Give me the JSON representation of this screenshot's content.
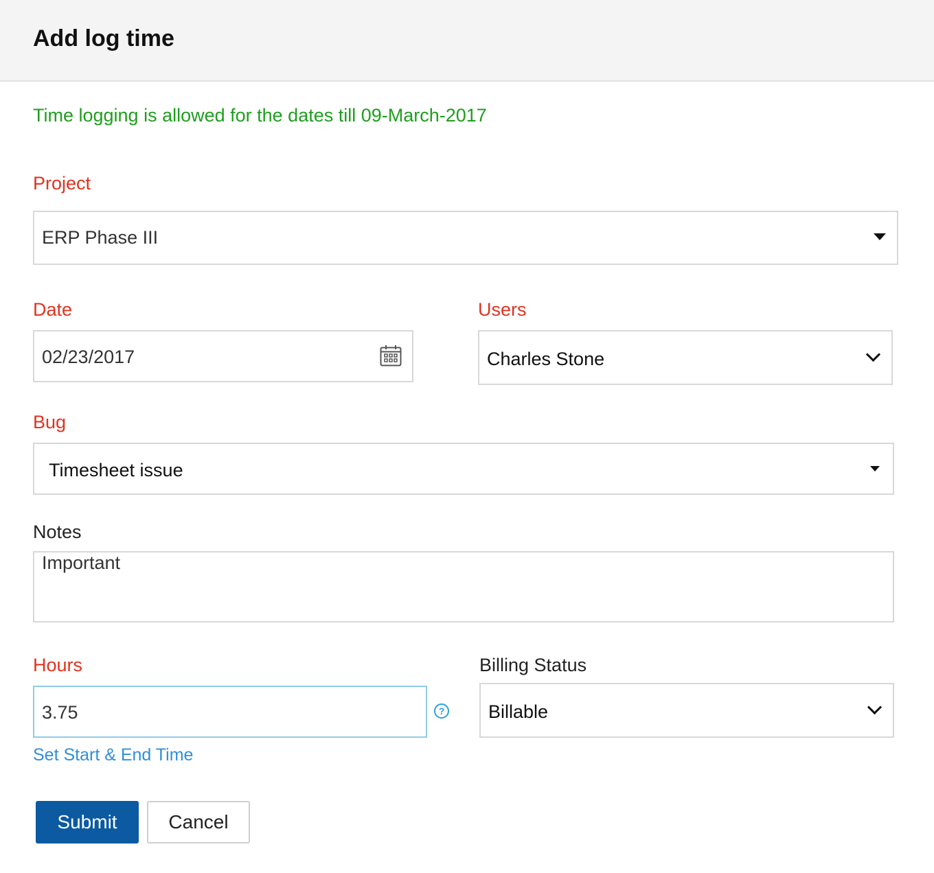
{
  "dialog": {
    "title": "Add log time"
  },
  "info_message": "Time logging is allowed for the dates till 09-March-2017",
  "project": {
    "label": "Project",
    "value": "ERP Phase III"
  },
  "date": {
    "label": "Date",
    "value": "02/23/2017"
  },
  "users": {
    "label": "Users",
    "value": "Charles Stone"
  },
  "bug": {
    "label": "Bug",
    "value": "Timesheet issue"
  },
  "notes": {
    "label": "Notes",
    "value": "Important"
  },
  "hours": {
    "label": "Hours",
    "value": "3.75",
    "help_symbol": "?"
  },
  "billing": {
    "label": "Billing Status",
    "value": "Billable"
  },
  "set_time_link": "Set Start & End Time",
  "buttons": {
    "submit": "Submit",
    "cancel": "Cancel"
  },
  "colors": {
    "required_label": "#e0331f",
    "info": "#1e9e1e",
    "link": "#2f8fd8",
    "primary_button": "#0b5aa2",
    "focus_border": "#8fcbe8"
  },
  "icons": {
    "date": "calendar-icon",
    "help": "help-icon",
    "project_dropdown": "caret-down-icon",
    "bug_dropdown": "caret-down-icon",
    "users_dropdown": "chevron-down-icon",
    "billing_dropdown": "chevron-down-icon"
  }
}
